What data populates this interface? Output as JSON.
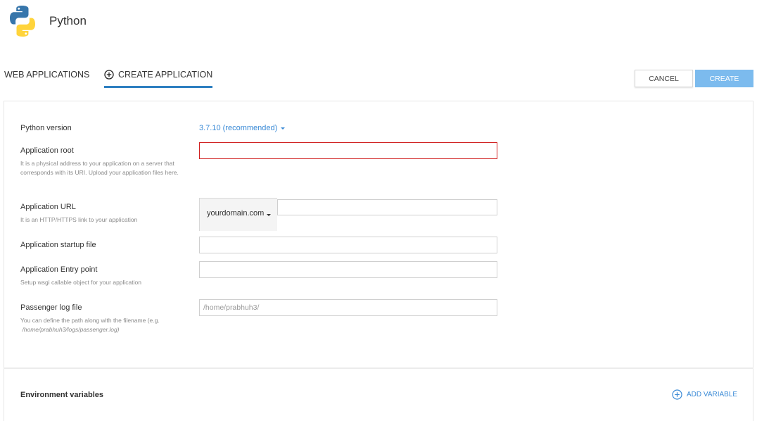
{
  "header": {
    "title": "Python",
    "logo_icon": "python-logo-icon"
  },
  "tabs": [
    {
      "label": "WEB APPLICATIONS",
      "active": false
    },
    {
      "label": "CREATE APPLICATION",
      "active": true,
      "icon": "plus-circle-icon"
    }
  ],
  "actions": {
    "cancel_label": "CANCEL",
    "create_label": "CREATE"
  },
  "form": {
    "python_version": {
      "label": "Python version",
      "value": "3.7.10 (recommended)"
    },
    "app_root": {
      "label": "Application root",
      "hint": "It is a physical address to your application on a server that corresponds with its URI. Upload your application files here.",
      "value": ""
    },
    "app_url": {
      "label": "Application URL",
      "hint": "It is an HTTP/HTTPS link to your application",
      "domain": "yourdomain.com",
      "value": ""
    },
    "startup_file": {
      "label": "Application startup file",
      "value": ""
    },
    "entry_point": {
      "label": "Application Entry point",
      "hint": "Setup wsgi callable object for your application",
      "value": ""
    },
    "passenger_log": {
      "label": "Passenger log file",
      "hint": "You can define the path along with the filename (e.g.",
      "hint_example": "/home/prabhuh3/logs/passenger.log)",
      "placeholder": "/home/prabhuh3/"
    }
  },
  "env": {
    "title": "Environment variables",
    "add_label": "ADD VARIABLE"
  },
  "colors": {
    "accent": "#2e7fc1",
    "link": "#3a8ad6",
    "create_button": "#7cbbee",
    "error": "#d02020"
  }
}
